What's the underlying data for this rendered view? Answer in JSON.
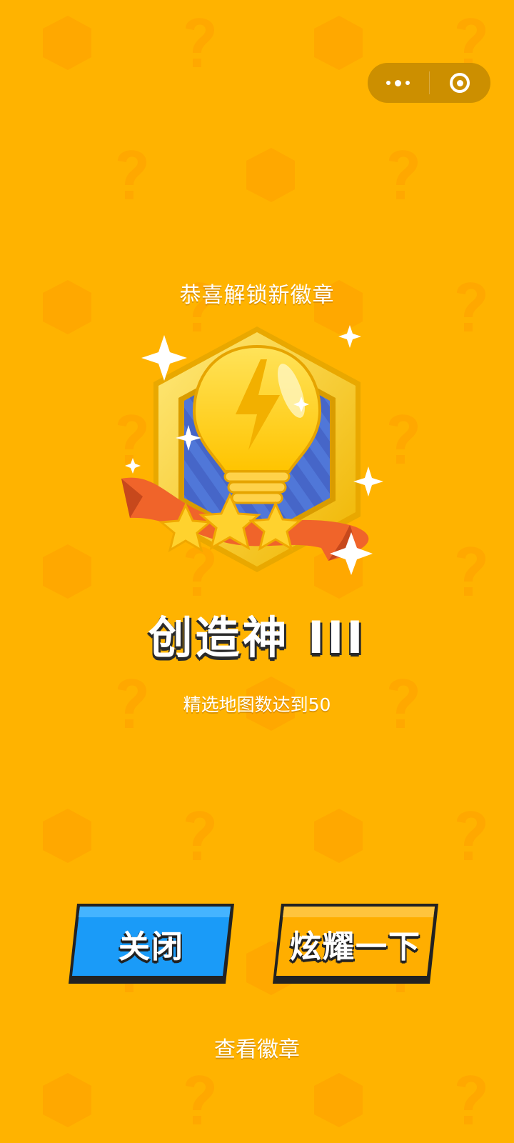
{
  "header": {
    "more_icon": "more-dots-icon",
    "close_icon": "target-close-icon"
  },
  "unlock": {
    "headline": "恭喜解锁新徽章",
    "badge_name": "创造神 III",
    "badge_desc": "精选地图数达到50",
    "badge_icon": "lightbulb-badge-icon",
    "stars": 3
  },
  "actions": {
    "close_label": "关闭",
    "share_label": "炫耀一下",
    "view_badges_label": "查看徽章"
  },
  "colors": {
    "background": "#ffb300",
    "close_button": "#1a9bf8",
    "share_button": "#ffae00"
  }
}
